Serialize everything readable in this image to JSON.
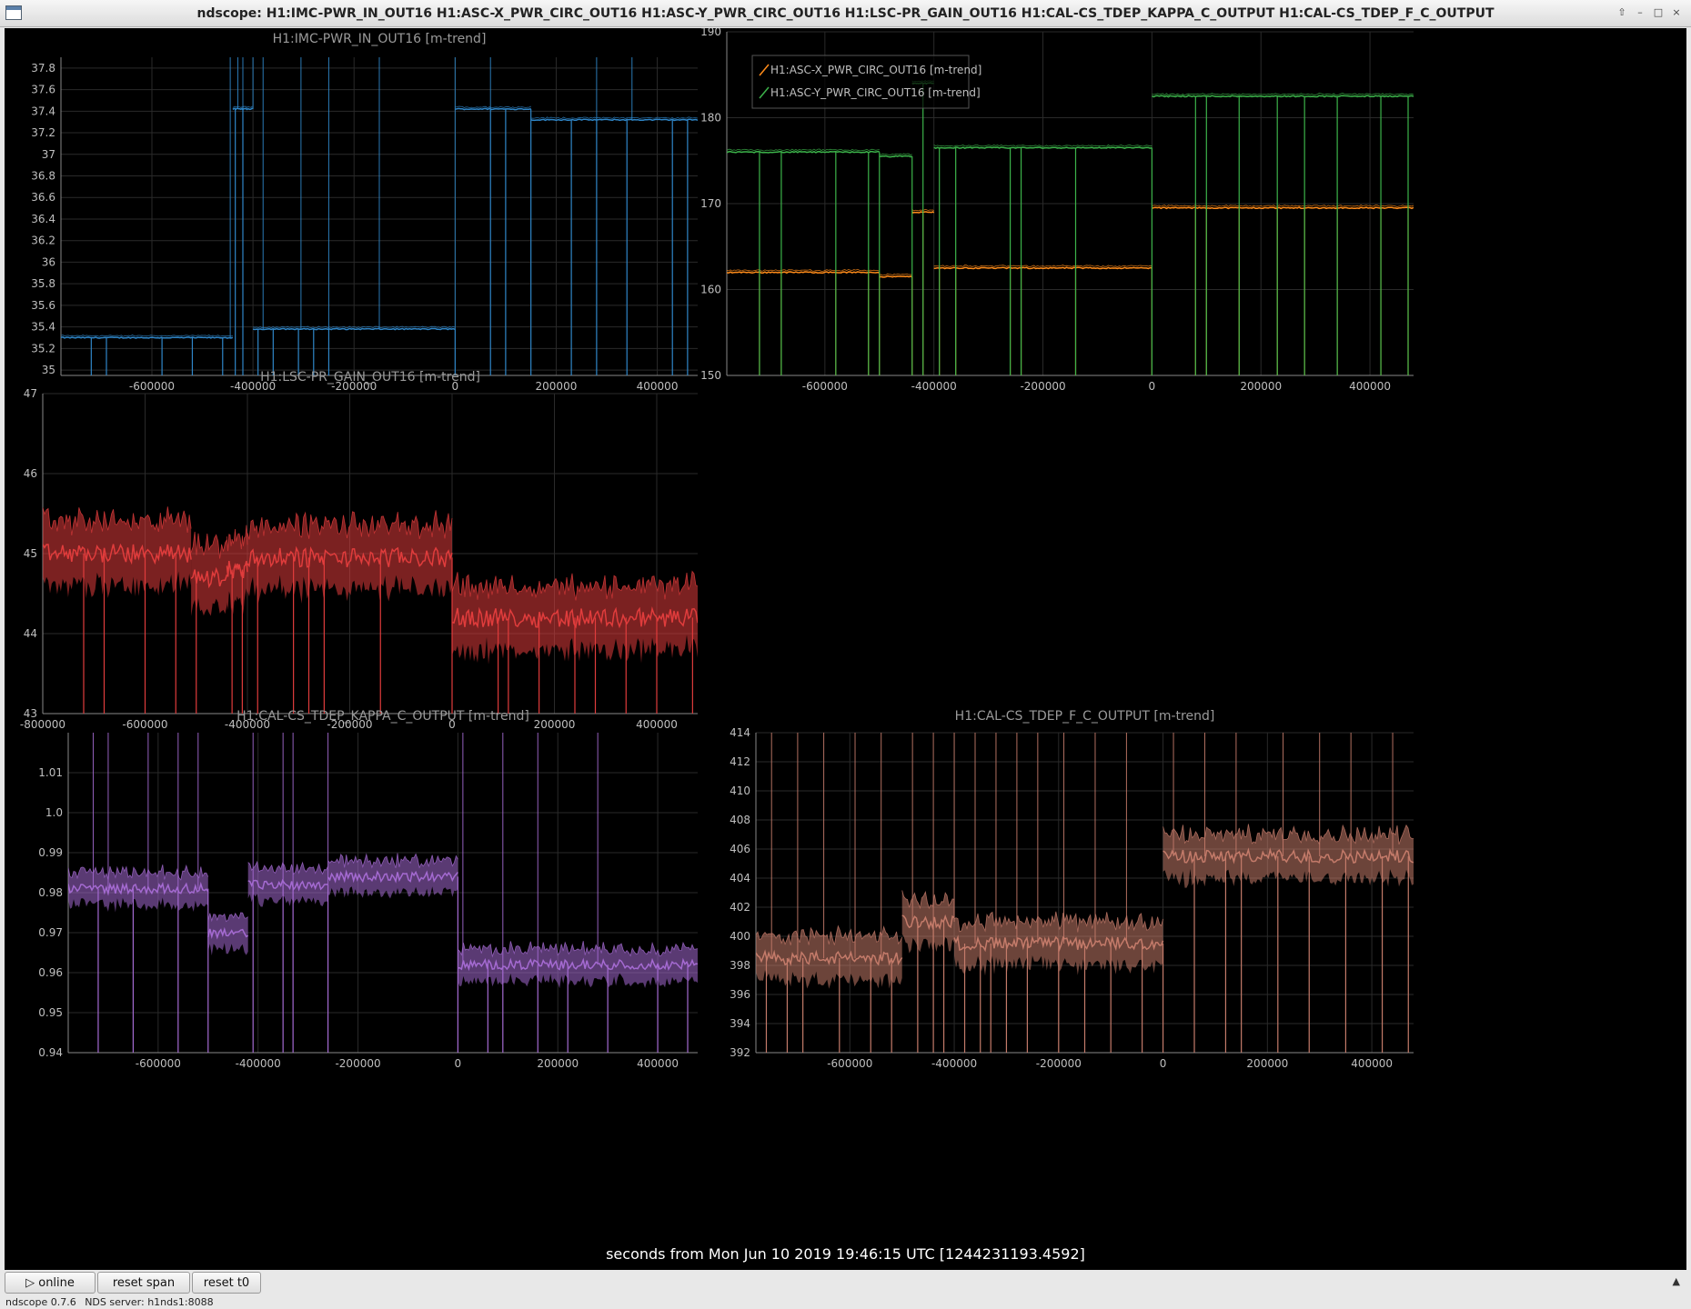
{
  "window": {
    "title": "ndscope: H1:IMC-PWR_IN_OUT16 H1:ASC-X_PWR_CIRC_OUT16 H1:ASC-Y_PWR_CIRC_OUT16 H1:LSC-PR_GAIN_OUT16 H1:CAL-CS_TDEP_KAPPA_C_OUTPUT H1:CAL-CS_TDEP_F_C_OUTPUT",
    "controls": [
      "up-icon",
      "minimize-icon",
      "maximize-icon",
      "close-icon"
    ]
  },
  "colors": {
    "background": "#000000",
    "grid": "#2a2a2a",
    "axis_text": "#bfbfbf",
    "title_text": "#9a9a9a",
    "imc": "#2f86c8",
    "asc_x": "#ff8c1a",
    "asc_y": "#3cb34a",
    "lsc": "#e03c3c",
    "kappa": "#a46ad1",
    "fc": "#c47b6a"
  },
  "chart_data": [
    {
      "type": "line",
      "title": "H1:IMC-PWR_IN_OUT16 [m-trend]",
      "xticks": [
        "-600000",
        "-400000",
        "-200000",
        "0",
        "200000",
        "400000"
      ],
      "yticks": [
        "35",
        "35.2",
        "35.4",
        "35.6",
        "35.8",
        "36",
        "36.2",
        "36.4",
        "36.6",
        "36.8",
        "37",
        "37.2",
        "37.4",
        "37.6",
        "37.8"
      ],
      "xlim": [
        -780000,
        480000
      ],
      "ylim": [
        34.95,
        37.9
      ],
      "grid": true,
      "series": [
        {
          "color_key": "imc",
          "segments": [
            {
              "x0": -780000,
              "x1": -440000,
              "y": 35.3
            },
            {
              "x0": -440000,
              "x1": -400000,
              "y": 37.42
            },
            {
              "x0": -400000,
              "x1": 0,
              "y": 35.38
            },
            {
              "x0": 0,
              "x1": 150000,
              "y": 37.42
            },
            {
              "x0": 150000,
              "x1": 480000,
              "y": 37.32
            }
          ],
          "spikes_down": [
            -720000,
            -690000,
            -580000,
            -520000,
            -460000,
            -435000,
            -420000,
            -390000,
            -360000,
            -310000,
            -280000,
            -250000,
            0,
            70000,
            100000,
            150000,
            230000,
            280000,
            340000,
            430000,
            460000
          ],
          "spikes_up": [
            -445000,
            -430000,
            -420000,
            -400000,
            -380000,
            -305000,
            -250000,
            -150000,
            0,
            70000,
            280000,
            350000
          ]
        }
      ]
    },
    {
      "type": "line",
      "legend": [
        "H1:ASC-X_PWR_CIRC_OUT16 [m-trend]",
        "H1:ASC-Y_PWR_CIRC_OUT16 [m-trend]"
      ],
      "legend_position": "top-left",
      "xticks": [
        "-600000",
        "-400000",
        "-200000",
        "0",
        "200000",
        "400000"
      ],
      "yticks": [
        "150",
        "160",
        "170",
        "180",
        "190"
      ],
      "xlim": [
        -780000,
        480000
      ],
      "ylim": [
        150,
        190
      ],
      "grid": true,
      "series": [
        {
          "name": "H1:ASC-X_PWR_CIRC_OUT16 [m-trend]",
          "color_key": "asc_x",
          "segments": [
            {
              "x0": -780000,
              "x1": -500000,
              "y": 162
            },
            {
              "x0": -500000,
              "x1": -440000,
              "y": 161.5
            },
            {
              "x0": -440000,
              "x1": -400000,
              "y": 169
            },
            {
              "x0": -400000,
              "x1": 0,
              "y": 162.5
            },
            {
              "x0": 0,
              "x1": 480000,
              "y": 169.5
            }
          ]
        },
        {
          "name": "H1:ASC-Y_PWR_CIRC_OUT16 [m-trend]",
          "color_key": "asc_y",
          "segments": [
            {
              "x0": -780000,
              "x1": -500000,
              "y": 176
            },
            {
              "x0": -500000,
              "x1": -440000,
              "y": 175.5
            },
            {
              "x0": -440000,
              "x1": -400000,
              "y": 184
            },
            {
              "x0": -400000,
              "x1": 0,
              "y": 176.5
            },
            {
              "x0": 0,
              "x1": 480000,
              "y": 182.5
            }
          ]
        }
      ],
      "spikes_down": [
        -720000,
        -680000,
        -580000,
        -520000,
        -500000,
        -440000,
        -420000,
        -390000,
        -360000,
        -260000,
        -240000,
        -140000,
        0,
        80000,
        100000,
        160000,
        230000,
        280000,
        340000,
        420000,
        470000
      ]
    },
    {
      "type": "line",
      "title": "H1:LSC-PR_GAIN_OUT16 [m-trend]",
      "xticks": [
        "-800000",
        "-600000",
        "-400000",
        "-200000",
        "0",
        "200000",
        "400000"
      ],
      "yticks": [
        "43",
        "44",
        "45",
        "46",
        "47"
      ],
      "xlim": [
        -800000,
        480000
      ],
      "ylim": [
        43,
        47
      ],
      "grid": true,
      "series": [
        {
          "color_key": "lsc",
          "segments": [
            {
              "x0": -800000,
              "x1": -510000,
              "y": 45.0
            },
            {
              "x0": -510000,
              "x1": -440000,
              "y": 44.7
            },
            {
              "x0": -440000,
              "x1": -400000,
              "y": 44.8
            },
            {
              "x0": -400000,
              "x1": 0,
              "y": 44.95
            },
            {
              "x0": 0,
              "x1": 480000,
              "y": 44.2
            }
          ],
          "band": 0.4,
          "spikes_down": [
            -720000,
            -680000,
            -600000,
            -540000,
            -500000,
            -430000,
            -410000,
            -380000,
            -310000,
            -280000,
            -250000,
            -140000,
            0,
            90000,
            110000,
            170000,
            240000,
            280000,
            340000,
            400000,
            470000
          ]
        }
      ]
    },
    {
      "type": "line",
      "title": "H1:CAL-CS_TDEP_KAPPA_C_OUTPUT [m-trend]",
      "xticks": [
        "-600000",
        "-400000",
        "-200000",
        "0",
        "200000",
        "400000"
      ],
      "yticks": [
        "0.94",
        "0.95",
        "0.96",
        "0.97",
        "0.98",
        "0.99",
        "1.0",
        "1.01"
      ],
      "xlim": [
        -780000,
        480000
      ],
      "ylim": [
        0.94,
        1.02
      ],
      "grid": true,
      "series": [
        {
          "color_key": "kappa",
          "segments": [
            {
              "x0": -780000,
              "x1": -500000,
              "y": 0.981
            },
            {
              "x0": -500000,
              "x1": -420000,
              "y": 0.97
            },
            {
              "x0": -420000,
              "x1": -260000,
              "y": 0.982
            },
            {
              "x0": -260000,
              "x1": 0,
              "y": 0.984
            },
            {
              "x0": 0,
              "x1": 480000,
              "y": 0.962
            }
          ],
          "band": 0.004,
          "spikes_down": [
            -720000,
            -650000,
            -560000,
            -500000,
            -410000,
            -350000,
            -330000,
            -260000,
            0,
            60000,
            90000,
            160000,
            220000,
            300000,
            400000,
            460000
          ],
          "spikes_up": [
            -730000,
            -700000,
            -620000,
            -560000,
            -520000,
            -410000,
            -350000,
            -330000,
            -260000,
            10000,
            90000,
            160000,
            280000
          ]
        }
      ]
    },
    {
      "type": "line",
      "title": "H1:CAL-CS_TDEP_F_C_OUTPUT [m-trend]",
      "xticks": [
        "-600000",
        "-400000",
        "-200000",
        "0",
        "200000",
        "400000"
      ],
      "yticks": [
        "392",
        "394",
        "396",
        "398",
        "400",
        "402",
        "404",
        "406",
        "408",
        "410",
        "412",
        "414"
      ],
      "xlim": [
        -780000,
        480000
      ],
      "ylim": [
        392,
        414
      ],
      "grid": true,
      "series": [
        {
          "color_key": "fc",
          "segments": [
            {
              "x0": -780000,
              "x1": -500000,
              "y": 398.5
            },
            {
              "x0": -500000,
              "x1": -400000,
              "y": 401
            },
            {
              "x0": -400000,
              "x1": 0,
              "y": 399.5
            },
            {
              "x0": 0,
              "x1": 480000,
              "y": 405.5
            }
          ],
          "band": 1.5,
          "spikes_down": [
            -760000,
            -720000,
            -690000,
            -620000,
            -560000,
            -520000,
            -470000,
            -440000,
            -420000,
            -380000,
            -350000,
            -330000,
            -300000,
            -260000,
            -200000,
            -150000,
            -100000,
            -40000,
            0,
            60000,
            120000,
            150000,
            220000,
            280000,
            350000,
            420000,
            470000
          ],
          "spikes_up": [
            -750000,
            -700000,
            -650000,
            -590000,
            -540000,
            -480000,
            -440000,
            -400000,
            -360000,
            -320000,
            -280000,
            -240000,
            -190000,
            -130000,
            -70000,
            20000,
            80000,
            140000,
            230000,
            300000,
            360000,
            440000
          ]
        }
      ]
    }
  ],
  "x_axis_label": "seconds from Mon Jun 10 2019 19:46:15 UTC [1244231193.4592]",
  "toolbar": {
    "online_label": "online",
    "online_icon": "play-icon",
    "reset_span_label": "reset span",
    "reset_t0_label": "reset t0"
  },
  "status": {
    "version": "ndscope 0.7.6",
    "server": "NDS server: h1nds1:8088"
  }
}
